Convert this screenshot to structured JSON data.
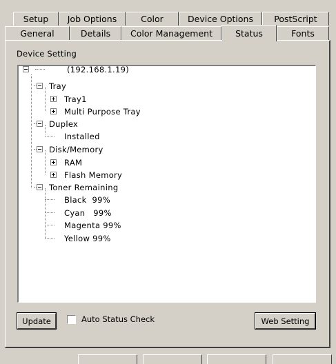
{
  "tabs_row1": [
    "Setup",
    "Job Options",
    "Color",
    "Device Options",
    "PostScript"
  ],
  "tabs_row2": [
    "General",
    "Details",
    "Color Management",
    "Status",
    "Fonts"
  ],
  "active_tab": "Status",
  "group_label": "Device Setting",
  "tree": {
    "root": "(192.168.1.19)",
    "tray": "Tray",
    "tray1": "Tray1",
    "multi_purpose_tray": "Multi Purpose Tray",
    "duplex": "Duplex",
    "installed": "Installed",
    "disk_memory": "Disk/Memory",
    "ram": "RAM",
    "flash_memory": "Flash Memory",
    "toner_remaining": "Toner Remaining",
    "black": "Black  99%",
    "cyan": "Cyan   99%",
    "magenta": "Magenta 99%",
    "yellow": "Yellow 99%"
  },
  "buttons": {
    "update": "Update",
    "web_setting": "Web Setting"
  },
  "auto_status_check": {
    "label": "Auto Status Check",
    "checked": false
  }
}
